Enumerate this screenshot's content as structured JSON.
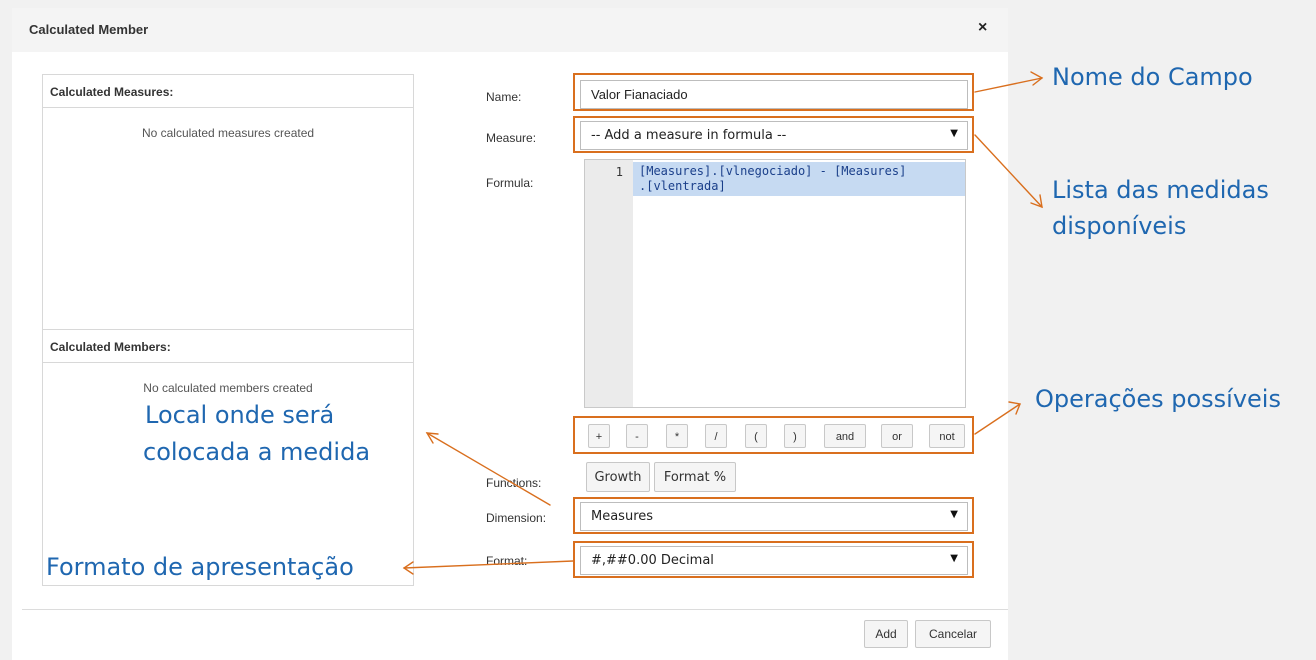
{
  "dialog": {
    "title": "Calculated Member",
    "close_glyph": "×"
  },
  "left_panel": {
    "measures_header": "Calculated Measures:",
    "measures_empty": "No calculated measures created",
    "members_header": "Calculated Members:",
    "members_empty": "No calculated members created"
  },
  "form": {
    "name_label": "Name:",
    "name_value": "Valor Fianaciado",
    "measure_label": "Measure:",
    "measure_value": "-- Add a measure in formula --",
    "formula_label": "Formula:",
    "formula_line_number": "1",
    "formula_text": "[Measures].[vlnegociado] - [Measures].[vlentrada]",
    "formula_line1": "[Measures].[vlnegociado] - [Measures]",
    "formula_line2": ".[vlentrada]",
    "operators": [
      "+",
      "-",
      "*",
      "/",
      "(",
      ")",
      "and",
      "or",
      "not"
    ],
    "functions_label": "Functions:",
    "functions": [
      "Growth",
      "Format %"
    ],
    "dimension_label": "Dimension:",
    "dimension_value": "Measures",
    "format_label": "Format:",
    "format_value": "#,##0.00 Decimal",
    "dropdown_caret": "▼"
  },
  "footer": {
    "add_label": "Add",
    "cancel_label": "Cancelar"
  },
  "annotations": {
    "nome_do_campo": "Nome do Campo",
    "lista_line1": "Lista das medidas",
    "lista_line2": "disponíveis",
    "operacoes": "Operações possíveis",
    "local_line1": "Local onde será",
    "local_line2": "colocada a medida",
    "formato": "Formato de apresentação"
  },
  "colors": {
    "highlight_border": "#d96f1e",
    "annotation_text": "#1f67b0",
    "formula_highlight": "#c6daf2"
  }
}
